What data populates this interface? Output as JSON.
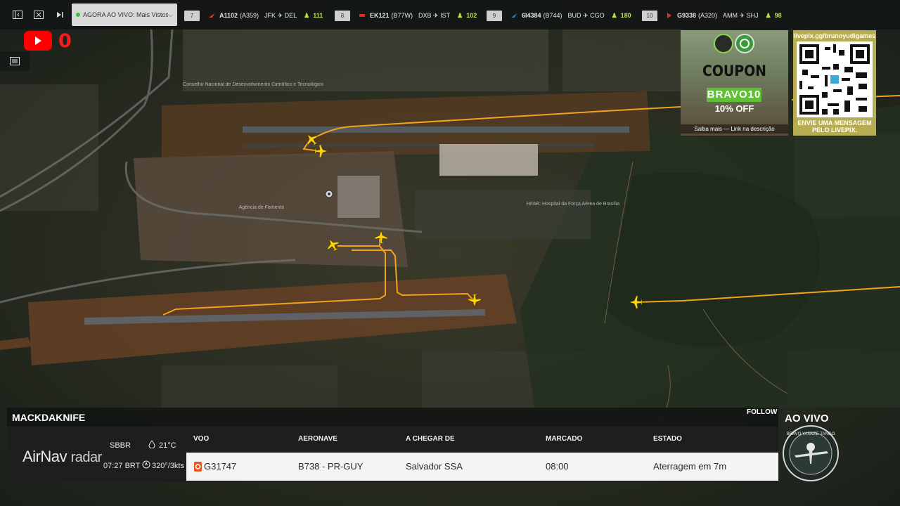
{
  "topbar": {
    "live_label": "AGORA AO VIVO: Mais Vistos",
    "flights": [
      {
        "rank": "7",
        "callsign": "A1102",
        "type": "(A359)",
        "route": "JFK ✈ DEL",
        "count": "111",
        "color": "#d23a3a"
      },
      {
        "rank": "8",
        "callsign": "EK121",
        "type": "(B77W)",
        "route": "DXB ✈ IST",
        "count": "102",
        "color": "#d62b2b"
      },
      {
        "rank": "9",
        "callsign": "6I4384",
        "type": "(B744)",
        "route": "BUD ✈ CGO",
        "count": "180",
        "color": "#3a6bd1"
      },
      {
        "rank": "10",
        "callsign": "G9338",
        "type": "(A320)",
        "route": "AMM ✈ SHJ",
        "count": "98",
        "color": "#e02f2f"
      }
    ]
  },
  "youtube": {
    "count": "0"
  },
  "map_labels": [
    "Conselho Nacional de Desenvolvimento Científico e Tecnológico",
    "HFAB: Hospital da Força Aérea de Brasília",
    "Agência de Fomento"
  ],
  "coupon": {
    "title": "COUPON",
    "code": "BRAVO10",
    "discount": "10% OFF",
    "footer": "Saiba mais — Link na descrição"
  },
  "qr": {
    "url": "livepix.gg/brunoyudigames",
    "message": "ENVIE UMA MENSAGEM PELO LIVEPIX."
  },
  "panel": {
    "username": "MACKDAKNIFE",
    "follow": "FOLLOW",
    "brand": "AirNav",
    "brand_suffix": "radar",
    "airport": "SBBR",
    "time": "07:27 BRT",
    "temperature": "21°C",
    "wind": "320°/3kts",
    "headers": {
      "flight": "VOO",
      "aircraft": "AERONAVE",
      "origin": "A CHEGAR DE",
      "scheduled": "MARCADO",
      "status": "ESTADO"
    },
    "row": {
      "flight": "G31747",
      "aircraft": "B738 - PR-GUY",
      "origin": "Salvador SSA",
      "scheduled": "08:00",
      "status": "Aterragem em 7m"
    }
  },
  "live_badge": {
    "label": "AO VIVO",
    "name": "BRAVO YANKEE TANGO"
  },
  "colors": {
    "track": "#f2a31b",
    "aircraft": "#ffd400",
    "accent": "#b7e34a",
    "brand_red": "#ff1a1a"
  }
}
